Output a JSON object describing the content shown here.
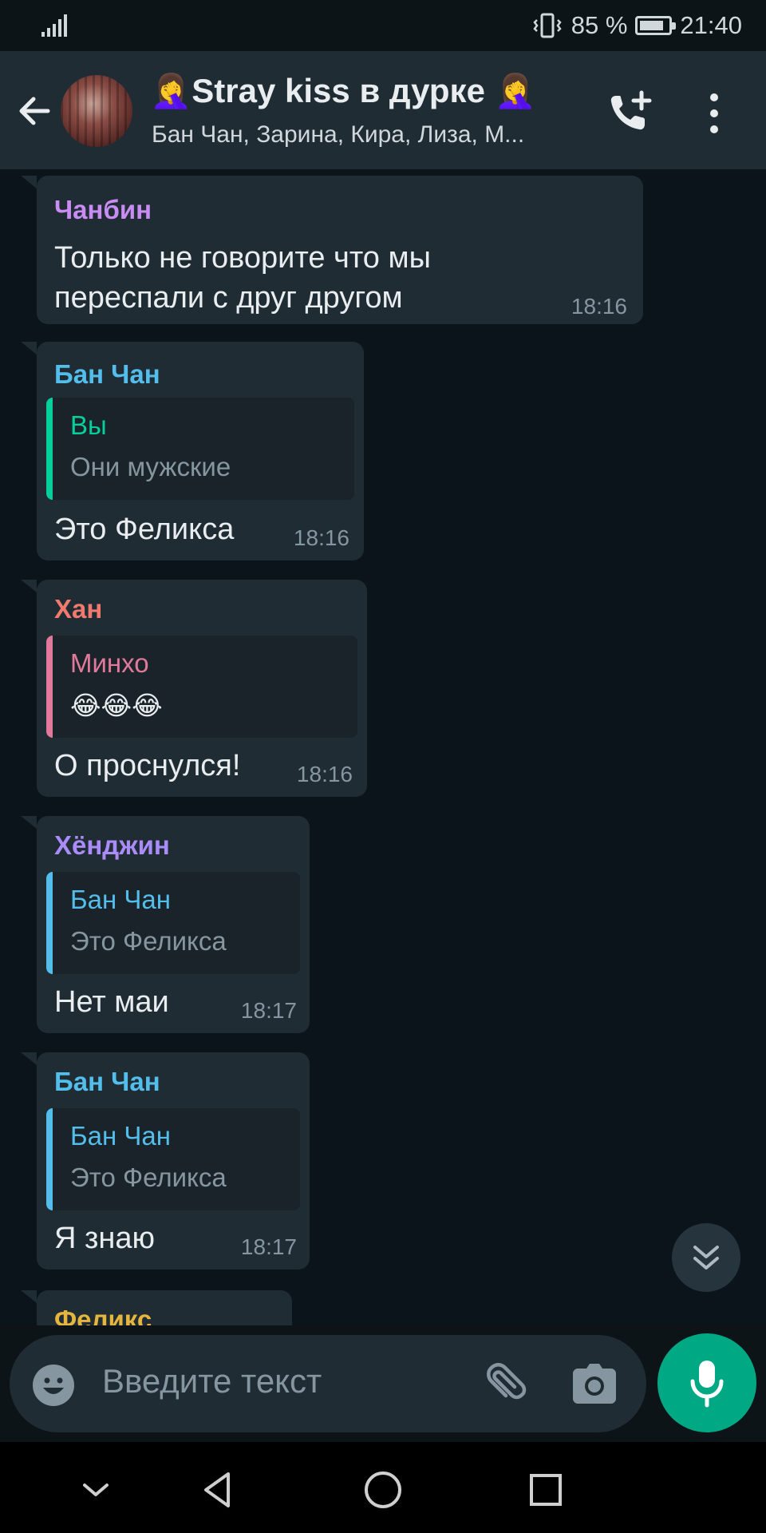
{
  "status_bar": {
    "battery": "85 %",
    "time": "21:40",
    "battery_level": 0.85
  },
  "header": {
    "title": "🤦‍♀️Stray kiss в дурке 🤦‍♀️",
    "subtitle": "Бан Чан, Зарина, Кира, Лиза, М..."
  },
  "colors": {
    "changbin": "#c88cf3",
    "banchan": "#53bdeb",
    "han": "#f07a6d",
    "hyunjin": "#a98cf8",
    "felix": "#e5b53d",
    "you": "#06cf9c",
    "minho": "#e17a9a",
    "accent": "#00a884"
  },
  "messages": [
    {
      "sender": "Чанбин",
      "lines": [
        "Только не говорите что мы",
        "переспали с друг другом"
      ],
      "time": "18:16"
    },
    {
      "sender": "Бан Чан",
      "quote": {
        "name": "Вы",
        "text": "Они мужские"
      },
      "text": "Это Феликса",
      "time": "18:16"
    },
    {
      "sender": "Хан",
      "quote": {
        "name": "Минхо",
        "text": "😂😂😂"
      },
      "text": "О проснулся!",
      "time": "18:16"
    },
    {
      "sender": "Хёнджин",
      "quote": {
        "name": "Бан Чан",
        "text": "Это Феликса"
      },
      "text": "Нет маи",
      "time": "18:17"
    },
    {
      "sender": "Бан Чан",
      "quote": {
        "name": "Бан Чан",
        "text": "Это Феликса"
      },
      "text": "Я знаю",
      "time": "18:17"
    },
    {
      "sender": "Феликс"
    }
  ],
  "input": {
    "placeholder": "Введите текст"
  },
  "icons": {
    "back": "arrow-left-icon",
    "call_add": "phone-plus-icon",
    "menu": "more-vert-icon",
    "emoji": "emoji-icon",
    "attach": "paperclip-icon",
    "camera": "camera-icon",
    "mic": "microphone-icon",
    "scroll": "double-chevron-down-icon"
  }
}
